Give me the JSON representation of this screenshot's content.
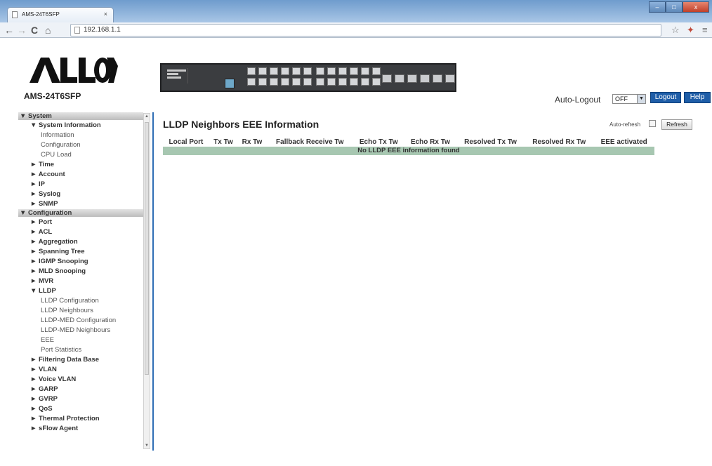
{
  "browser": {
    "tab_title": "AMS-24T6SFP",
    "tab_close": "×",
    "url": "192.168.1.1",
    "nav_back": "←",
    "nav_forward": "→",
    "nav_reload": "C",
    "nav_home": "⌂",
    "min": "–",
    "max": "□",
    "close": "x"
  },
  "header": {
    "logo_text": "ALLOY",
    "model": "AMS-24T6SFP",
    "auto_logout_label": "Auto-Logout",
    "auto_logout_value": "OFF",
    "logout_label": "Logout",
    "help_label": "Help"
  },
  "sidebar": {
    "system_header": "▼ System",
    "system_information": "▼ System Information",
    "info_items": [
      "Information",
      "Configuration",
      "CPU Load"
    ],
    "system_items": [
      "► Time",
      "► Account",
      "► IP",
      "► Syslog",
      "► SNMP"
    ],
    "configuration_header": "▼ Configuration",
    "config_items_a": [
      "► Port",
      "► ACL",
      "► Aggregation",
      "► Spanning Tree",
      "► IGMP Snooping",
      "► MLD Snooping",
      "► MVR"
    ],
    "lldp": "▼ LLDP",
    "lldp_items": [
      "LLDP Configuration",
      "LLDP Neighbours",
      "LLDP-MED Configuration",
      "LLDP-MED Neighbours",
      "EEE",
      "Port Statistics"
    ],
    "config_items_b": [
      "► Filtering Data Base",
      "► VLAN",
      "► Voice VLAN",
      "► GARP",
      "► GVRP",
      "► QoS",
      "► Thermal Protection",
      "► sFlow Agent"
    ]
  },
  "main": {
    "title": "LLDP Neighbors EEE Information",
    "auto_refresh_label": "Auto-refresh",
    "refresh_label": "Refresh",
    "columns": [
      "Local Port",
      "Tx Tw",
      "Rx Tw",
      "Fallback Receive Tw",
      "Echo Tx Tw",
      "Echo Rx Tw",
      "Resolved Tx Tw",
      "Resolved Rx Tw",
      "EEE activated"
    ],
    "empty_message": "No LLDP EEE information found"
  },
  "colors": {
    "accent_blue": "#1f5ea8",
    "table_row": "#a7c7b1"
  }
}
